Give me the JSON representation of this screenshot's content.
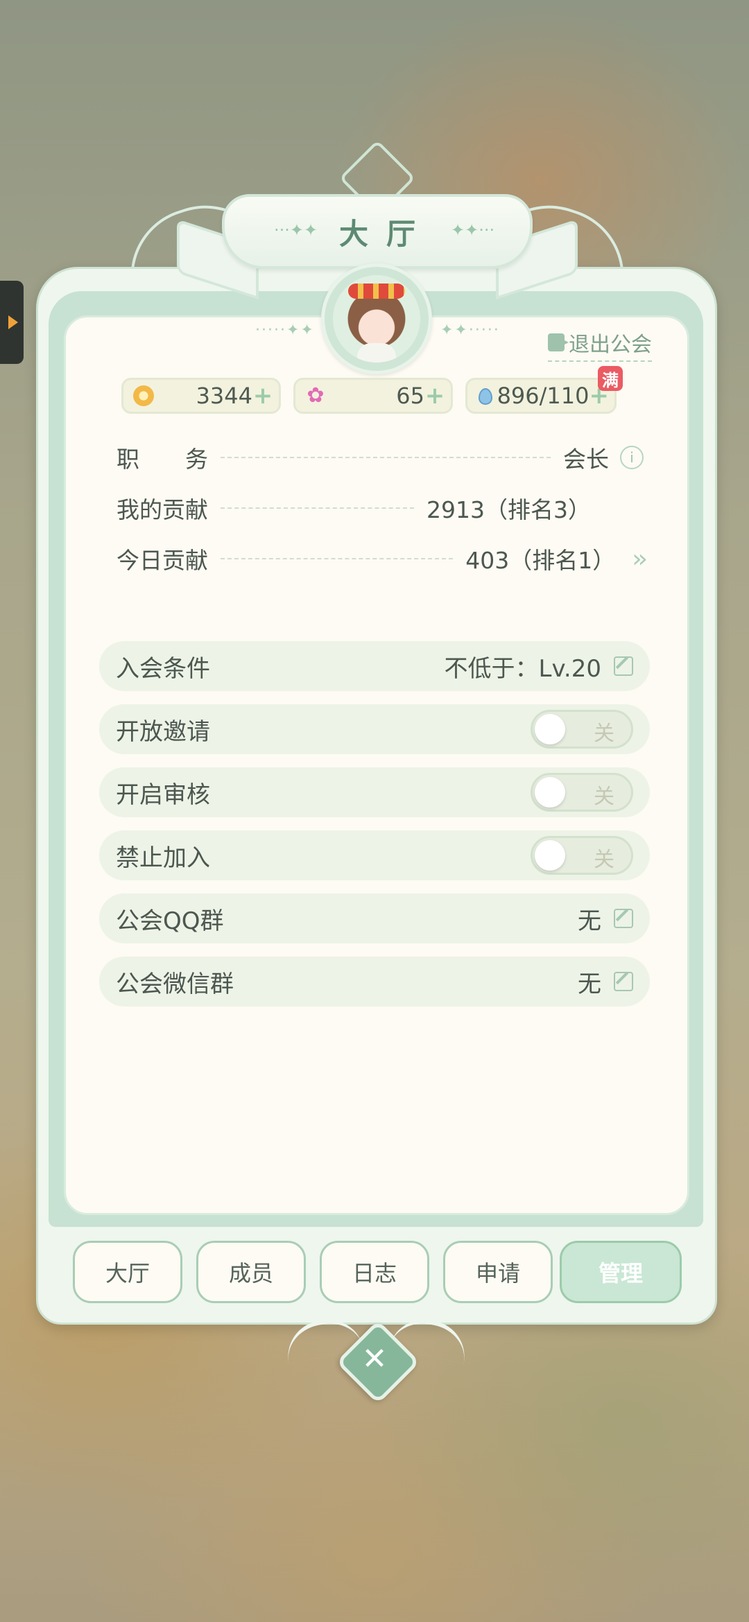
{
  "header": {
    "title": "大厅"
  },
  "exit_label": "退出公会",
  "resources": [
    {
      "icon": "coin-icon",
      "value": "3344"
    },
    {
      "icon": "flower-star-icon",
      "value": "65"
    },
    {
      "icon": "water-drop-icon",
      "value": "896/110",
      "badge": "满"
    }
  ],
  "info": [
    {
      "label": "职　　务",
      "value": "会长"
    },
    {
      "label": "我的贡献",
      "value": "2913（排名3）"
    },
    {
      "label": "今日贡献",
      "value": "403（排名1）"
    }
  ],
  "settings": [
    {
      "label": "入会条件",
      "value": "不低于：Lv.20"
    },
    {
      "label": "开放邀请",
      "toggle": "关"
    },
    {
      "label": "开启审核",
      "toggle": "关"
    },
    {
      "label": "禁止加入",
      "toggle": "关"
    },
    {
      "label": "公会QQ群",
      "value": "无"
    },
    {
      "label": "公会微信群",
      "value": "无"
    }
  ],
  "tabs": [
    {
      "label": "大厅"
    },
    {
      "label": "成员"
    },
    {
      "label": "日志"
    },
    {
      "label": "申请"
    },
    {
      "label": "管理",
      "active": true
    }
  ],
  "colors": {
    "accent": "#86b79a",
    "panel": "#fdfbf3",
    "badge": "#ea5b63"
  }
}
